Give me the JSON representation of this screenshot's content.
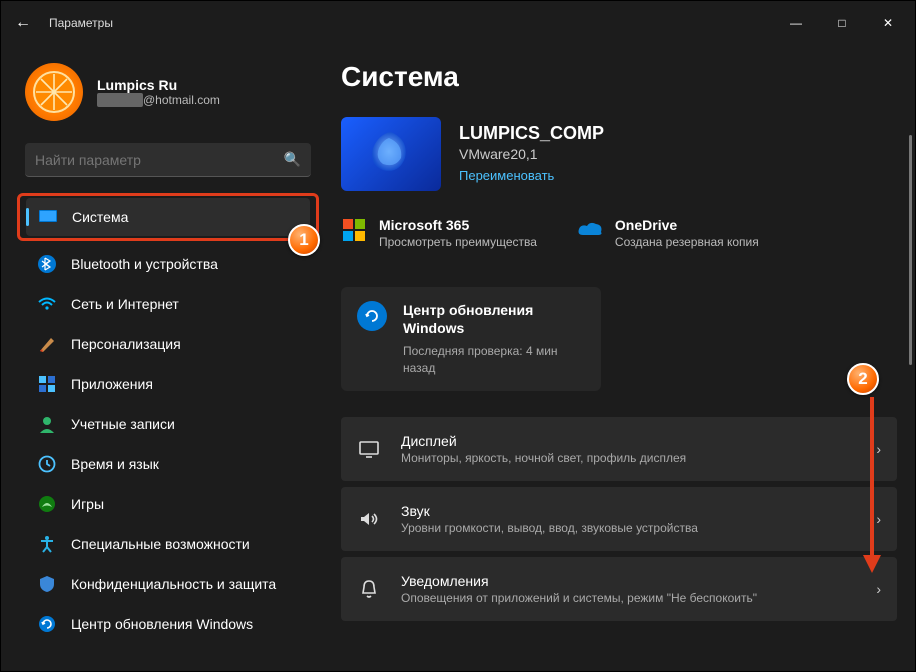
{
  "window": {
    "title": "Параметры"
  },
  "profile": {
    "name": "Lumpics Ru",
    "email_suffix": "@hotmail.com"
  },
  "search": {
    "placeholder": "Найти параметр"
  },
  "nav": {
    "items": [
      {
        "key": "system",
        "label": "Система",
        "selected": true
      },
      {
        "key": "bluetooth",
        "label": "Bluetooth и устройства"
      },
      {
        "key": "network",
        "label": "Сеть и Интернет"
      },
      {
        "key": "personalization",
        "label": "Персонализация"
      },
      {
        "key": "apps",
        "label": "Приложения"
      },
      {
        "key": "accounts",
        "label": "Учетные записи"
      },
      {
        "key": "time",
        "label": "Время и язык"
      },
      {
        "key": "gaming",
        "label": "Игры"
      },
      {
        "key": "accessibility",
        "label": "Специальные возможности"
      },
      {
        "key": "privacy",
        "label": "Конфиденциальность и защита"
      },
      {
        "key": "update",
        "label": "Центр обновления Windows"
      }
    ]
  },
  "page": {
    "title": "Система"
  },
  "device": {
    "name": "LUMPICS_COMP",
    "model": "VMware20,1",
    "rename_label": "Переименовать"
  },
  "promos": {
    "m365": {
      "title": "Microsoft 365",
      "subtitle": "Просмотреть преимущества"
    },
    "onedrive": {
      "title": "OneDrive",
      "subtitle": "Создана резервная копия"
    }
  },
  "update": {
    "title": "Центр обновления Windows",
    "subtitle": "Последняя проверка: 4 мин назад"
  },
  "cards": [
    {
      "key": "display",
      "title": "Дисплей",
      "subtitle": "Мониторы, яркость, ночной свет, профиль дисплея"
    },
    {
      "key": "sound",
      "title": "Звук",
      "subtitle": "Уровни громкости, вывод, ввод, звуковые устройства"
    },
    {
      "key": "notifications",
      "title": "Уведомления",
      "subtitle": "Оповещения от приложений и системы, режим \"Не беспокоить\""
    }
  ],
  "markers": {
    "one": "1",
    "two": "2"
  }
}
